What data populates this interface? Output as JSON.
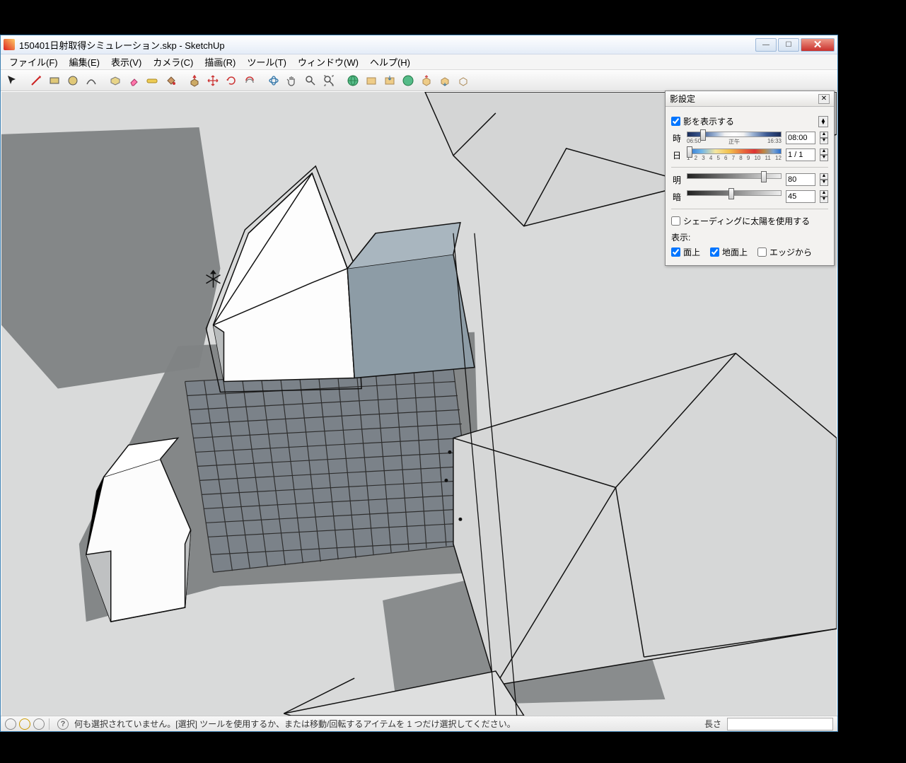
{
  "window": {
    "title": "150401日射取得シミュレーション.skp - SketchUp"
  },
  "menu": {
    "file": "ファイル(F)",
    "edit": "編集(E)",
    "view": "表示(V)",
    "camera": "カメラ(C)",
    "draw": "描画(R)",
    "tools": "ツール(T)",
    "window": "ウィンドウ(W)",
    "help": "ヘルプ(H)"
  },
  "status": {
    "message": "何も選択されていません。[選択] ツールを使用するか、または移動/回転するアイテムを 1 つだけ選択してください。",
    "length_label": "長さ"
  },
  "shadow_panel": {
    "title": "影設定",
    "show_shadows": "影を表示する",
    "time_label": "時",
    "time_start": "06:50",
    "time_noon": "正午",
    "time_end": "16:33",
    "time_value": "08:00",
    "date_label": "日",
    "date_value": "1 / 1",
    "light_label": "明",
    "light_value": "80",
    "dark_label": "暗",
    "dark_value": "45",
    "use_sun": "シェーディングに太陽を使用する",
    "display_label": "表示:",
    "on_faces": "面上",
    "on_ground": "地面上",
    "from_edges": "エッジから"
  }
}
